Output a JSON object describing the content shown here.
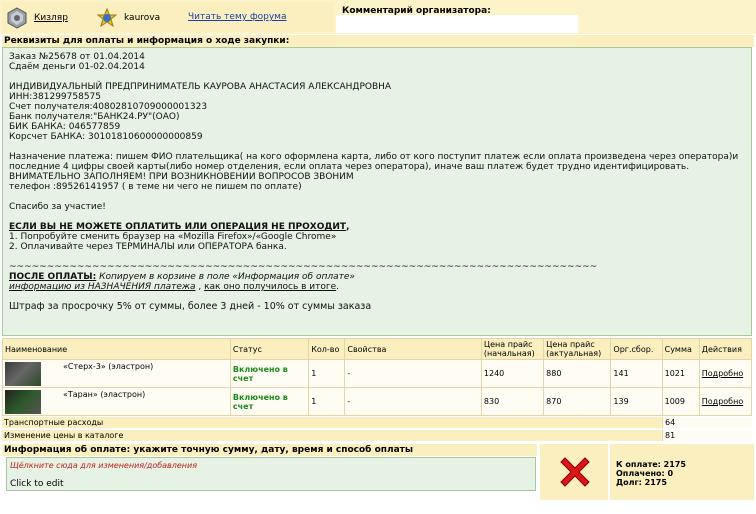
{
  "header": {
    "city": "Кизляр",
    "user": "kaurova",
    "forum_link": "Читать тему форума",
    "comment_label": "Комментарий организатора:"
  },
  "requisites": {
    "header": "Реквизиты для оплаты и информация о ходе закупки:",
    "lines": [
      "Заказ №25678 от 01.04.2014",
      "Сдаём деньги 01-02.04.2014",
      "",
      "ИНДИВИДУАЛЬНЫЙ ПРЕДПРИНИМАТЕЛЬ КАУРОВА АНАСТАСИЯ АЛЕКСАНДРОВНА",
      "ИНН:381299758575",
      "Счет получателя:40802810709000001323",
      "Банк получателя:\"БАНК24.РУ\"(ОАО)",
      "БИК БАНКА: 046577859",
      "Корсчет БАНКА: 30101810600000000859"
    ],
    "purpose": "Назначение платежа: пишем ФИО плательщика( на кого оформлена карта, либо от кого поступит платеж если оплата произведена через оператора)и последние 4 цифры своей карты(либо номер отделения, если оплата через оператора), иначе ваш платеж будет трудно идентифицировать.",
    "warning": "ВНИМАТЕЛЬНО ЗАПОЛНЯЕМ! ПРИ ВОЗНИКНОВЕНИИ ВОПРОСОВ ЗВОНИМ",
    "phone": "телефон :89526141957 ( в теме ни чего не пишем по оплате)",
    "thanks": "Спасибо за участие!",
    "cant_pay": "ЕСЛИ ВЫ НЕ МОЖЕТЕ ОПЛАТИТЬ ИЛИ ОПЕРАЦИЯ НЕ ПРОХОДИТ",
    "cant_pay_comma": ",",
    "tip1": "1. Попробуйте сменить браузер на «Mozilla Firefox»/«Google Chrome»",
    "tip2": "2. Оплачивайте через ТЕРМИНАЛЫ или ОПЕРАТОРА банка.",
    "tilde": "~~~~~~~~~~~~~~~~~~~~~~~~~~~~~~~~~~~~~~~~~~~~~~~~~~~~~~~~~~~~~~~~~~~~~~~~~~~~~~",
    "after_label": "ПОСЛЕ ОПЛАТЫ:",
    "after_1": "Копируем в корзине в поле «Информация об оплате»",
    "after_2": "информацию из НАЗНАЧЕНИЯ платежа",
    "after_3": " , ",
    "after_4": "как оно получилось в итоге",
    "after_5": ".",
    "fine": "Штраф за просрочку 5% от суммы, более 3 дней - 10% от суммы заказа"
  },
  "table": {
    "columns": [
      "Наименование",
      "Статус",
      "Кол-во",
      "Свойства",
      "Цена прайс (начальная)",
      "Цена прайс (актуальная)",
      "Орг.сбор.",
      "Сумма",
      "Действия"
    ],
    "rows": [
      {
        "name": "«Стерх-3» (эластрон)",
        "status": "Включено в счет",
        "qty": "1",
        "props": "-",
        "price_start": "1240",
        "price_actual": "880",
        "fee": "141",
        "sum": "1021",
        "action": "Подробно"
      },
      {
        "name": "«Таран» (эластрон)",
        "status": "Включено в счет",
        "qty": "1",
        "props": "-",
        "price_start": "830",
        "price_actual": "870",
        "fee": "139",
        "sum": "1009",
        "action": "Подробно"
      }
    ]
  },
  "summary": {
    "transport_label": "Транспортные расходы",
    "transport_value": "64",
    "price_change_label": "Изменение цены в каталоге",
    "price_change_value": "81"
  },
  "payment": {
    "header": "Информация об оплате: укажите точную сумму, дату, время и способ оплаты",
    "hint": "Щёлкните сюда для изменения/добавления",
    "click": "Click to edit"
  },
  "totals": {
    "to_pay": "К оплате: 2175",
    "paid": "Оплачено: 0",
    "debt": "Долг: 2175"
  }
}
